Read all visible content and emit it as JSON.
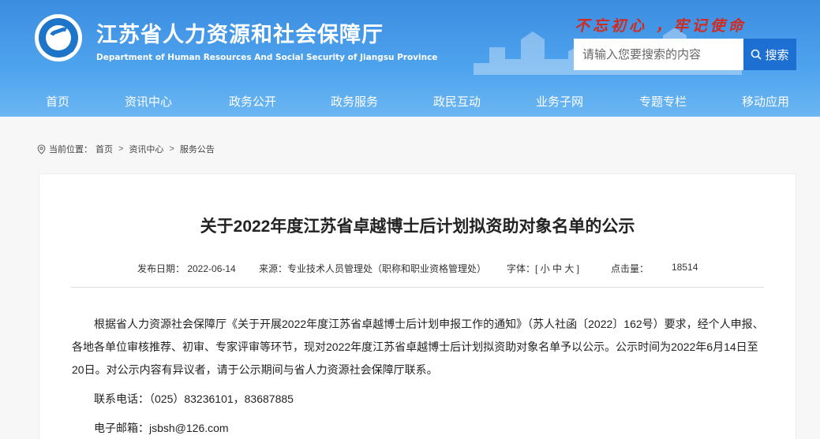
{
  "header": {
    "title_cn": "江苏省人力资源和社会保障厅",
    "title_en": "Department of Human Resources And Social Security of Jiangsu Province",
    "slogan": "不忘初心 ，牢记使命",
    "search_placeholder": "请输入您要搜索的内容",
    "search_button": "搜索",
    "accent_color": "#3b8de0",
    "slogan_color": "#d32a1e"
  },
  "nav": {
    "items": [
      "首页",
      "资讯中心",
      "政务公开",
      "政务服务",
      "政民互动",
      "业务子网",
      "专题专栏",
      "移动应用"
    ]
  },
  "breadcrumb": {
    "prefix": "当前位置：",
    "items": [
      "首页",
      "资讯中心",
      "服务公告"
    ]
  },
  "article": {
    "title": "关于2022年度江苏省卓越博士后计划拟资助对象名单的公示",
    "publish_date": "发布日期： 2022-06-14",
    "source": "来源：专业技术人员管理处（职称和职业资格管理处）",
    "font_size": "字体：[ 小  中  大 ]",
    "hits_label": "点击量：",
    "hits_value": "18514",
    "paragraph": "根据省人力资源社会保障厅《关于开展2022年度江苏省卓越博士后计划申报工作的通知》（苏人社函〔2022〕162号）要求，经个人申报、各地各单位审核推荐、初审、专家评审等环节，现对2022年度江苏省卓越博士后计划拟资助对象名单予以公示。公示时间为2022年6月14日至20日。对公示内容有异议者，请于公示期间与省人力资源社会保障厅联系。",
    "phone": "联系电话：（025）83236101，83687885",
    "email": "电子邮箱：jsbsh@126.com"
  }
}
